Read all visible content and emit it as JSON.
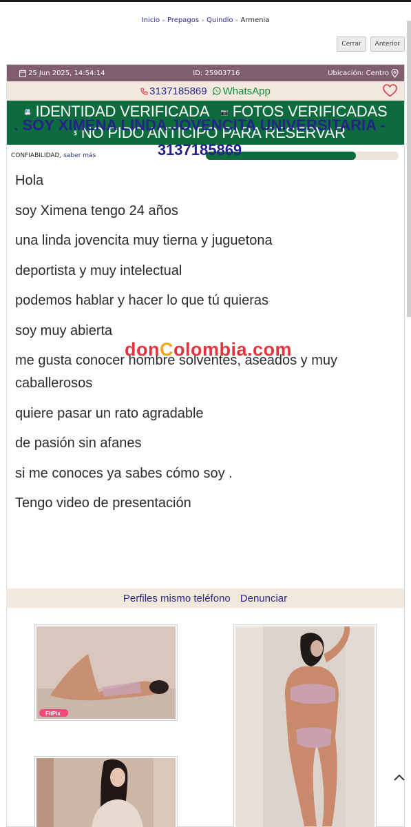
{
  "breadcrumb": {
    "items": [
      "Inicio",
      "Prepagos",
      "Quindío"
    ],
    "current": "Armenia",
    "separator": "»"
  },
  "nav": {
    "close_label": "Cerrar",
    "prev_label": "Anterior"
  },
  "meta": {
    "date": "25 Jun 2025, 14:54:14",
    "id": "ID: 25903716",
    "location": "Ubicación: Centro"
  },
  "contact": {
    "phone": "3137185869",
    "whatsapp": "WhatsApp"
  },
  "badges": {
    "identity": "IDENTIDAD VERIFICADA",
    "photos": "FOTOS VERIFICADAS",
    "no_deposit": "NO PIDO ANTICIPO PARA RESERVAR"
  },
  "trust": {
    "label": "CONFIABILIDAD,",
    "link": "saber más",
    "level_fraction": 0.78
  },
  "ad": {
    "title": ". SOY XIMENA LINDA JOVENCITA UNIVERSITARIA - 3137185869",
    "lines": [
      "Hola",
      "soy Ximena tengo 24 años",
      "una linda jovencita muy tierna y juguetona",
      "deportista y muy intelectual",
      "podemos hablar y hacer lo que tú quieras",
      "soy muy abierta",
      "me gusta conocer hombre solventes, aseados y muy caballerosos",
      "quiere pasar un rato agradable",
      "de pasión sin afanes",
      "si me conoces ya sabes cómo soy .",
      "Tengo video de presentación"
    ]
  },
  "watermark": {
    "part1": "don",
    "part2": "C",
    "part3": "olombia.com"
  },
  "links": {
    "same_phone": "Perfiles mismo teléfono",
    "report": "Denunciar"
  },
  "photo_badge": "FitPix",
  "colors": {
    "meta_bar": "#805d6f",
    "verified_green": "#0d6b3e",
    "accent_blue": "#23238a",
    "cream": "#f2e8dd",
    "whatsapp_green": "#128c3a",
    "heart_red": "#e0344a"
  }
}
